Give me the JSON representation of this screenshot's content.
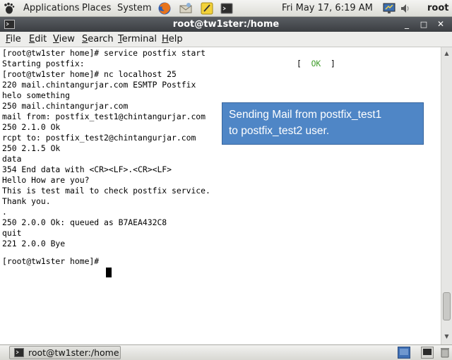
{
  "top_panel": {
    "menus": [
      "Applications",
      "Places",
      "System"
    ],
    "clock": "Fri May 17,  6:19 AM",
    "user": "root"
  },
  "window": {
    "title": "root@tw1ster:/home",
    "menu": [
      {
        "underline": "F",
        "rest": "ile"
      },
      {
        "underline": "E",
        "rest": "dit"
      },
      {
        "underline": "V",
        "rest": "iew"
      },
      {
        "underline": "S",
        "rest": "earch"
      },
      {
        "underline": "T",
        "rest": "erminal"
      },
      {
        "underline": "H",
        "rest": "elp"
      }
    ]
  },
  "terminal": {
    "lines": [
      "[root@tw1ster home]# service postfix start",
      "Starting postfix:",
      "[root@tw1ster home]# nc localhost 25",
      "220 mail.chintangurjar.com ESMTP Postfix",
      "helo something",
      "250 mail.chintangurjar.com",
      "mail from: postfix_test1@chintangurjar.com",
      "250 2.1.0 Ok",
      "rcpt to: postfix_test2@chintangurjar.com",
      "250 2.1.5 Ok",
      "data",
      "354 End data with <CR><LF>.<CR><LF>",
      "Hello How are you?",
      "This is test mail to check postfix service.",
      "Thank you.",
      ".",
      "250 2.0.0 Ok: queued as B7AEA432C8",
      "quit",
      "221 2.0.0 Bye",
      "[root@tw1ster home]# "
    ],
    "ok_bracket_open": "[",
    "ok_text": "OK",
    "ok_bracket_close": "]"
  },
  "callout": {
    "line1": "Sending Mail  from postfix_test1",
    "line2": "to postfix_test2 user."
  },
  "taskbar": {
    "label": "root@tw1ster:/home"
  },
  "colors": {
    "callout_bg": "#4f86c6",
    "ok_green": "#3f9d2b",
    "titlebar": "#46494d"
  }
}
